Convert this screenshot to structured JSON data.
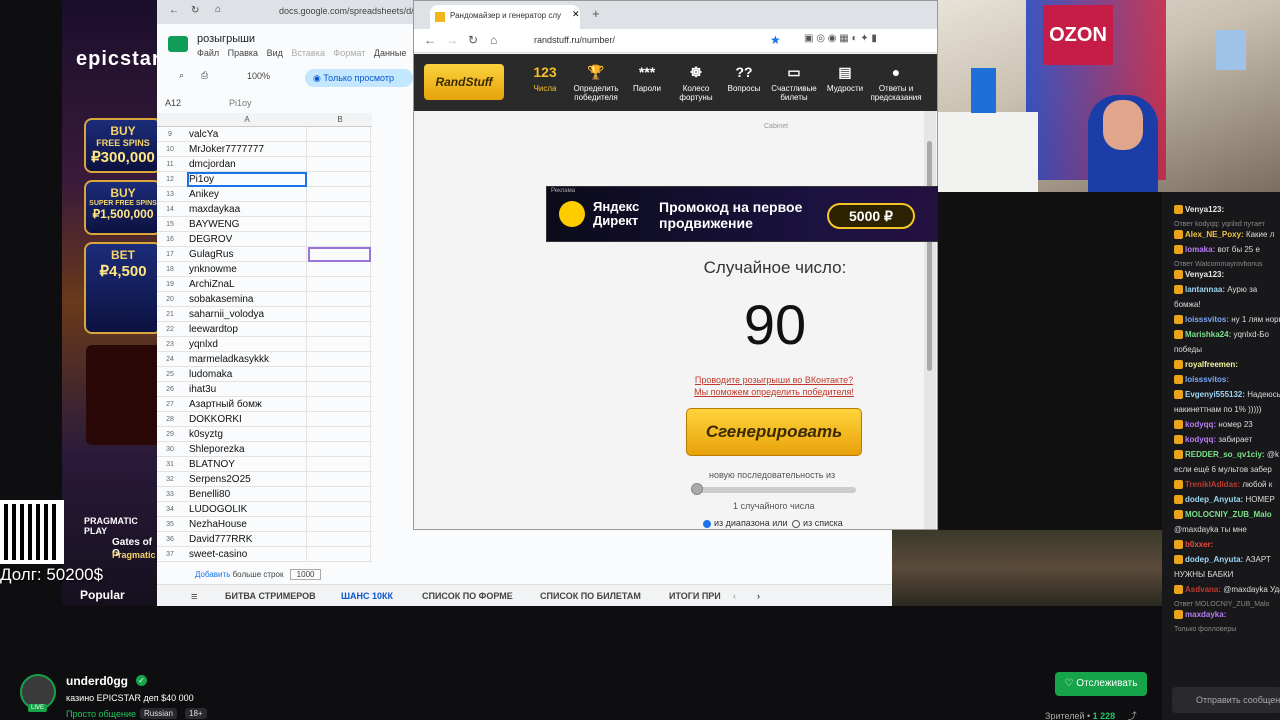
{
  "casino": {
    "logo": "epicstar",
    "tiles": [
      {
        "top": "BUY",
        "mid": "FREE SPINS",
        "big": "₽300,000"
      },
      {
        "top": "BUY",
        "mid": "SUPER FREE SPINS",
        "big": "₽1,500,000"
      },
      {
        "top": "BET",
        "mid": "",
        "big": "₽4,500"
      }
    ],
    "game_provider": "PRAGMATIC PLAY",
    "game_title": "Gates of O",
    "game_subtitle": "Pragmatic",
    "popular_label": "Popular"
  },
  "sheets": {
    "url": "docs.google.com/spreadsheets/d/",
    "title": "розыгрыши",
    "menu": [
      "Файл",
      "Правка",
      "Вид",
      "Вставка",
      "Формат",
      "Данные"
    ],
    "zoom": "100%",
    "view_only_label": "Только просмотр",
    "cell_ref": "A12",
    "formula": "Pi1oy",
    "col_a": "A",
    "col_b": "B",
    "rows": [
      {
        "n": "9",
        "v": "valcYa"
      },
      {
        "n": "10",
        "v": "MrJoker7777777"
      },
      {
        "n": "11",
        "v": "dmcjordan"
      },
      {
        "n": "12",
        "v": "Pi1oy"
      },
      {
        "n": "13",
        "v": "Anikey"
      },
      {
        "n": "14",
        "v": "maxdaykaa"
      },
      {
        "n": "15",
        "v": "BAYWENG"
      },
      {
        "n": "16",
        "v": "DEGROV"
      },
      {
        "n": "17",
        "v": "GulagRus"
      },
      {
        "n": "18",
        "v": "ynknowme"
      },
      {
        "n": "19",
        "v": "ArchiZnaL"
      },
      {
        "n": "20",
        "v": "sobakasemina"
      },
      {
        "n": "21",
        "v": "saharnii_volodya"
      },
      {
        "n": "22",
        "v": "leewardtop"
      },
      {
        "n": "23",
        "v": "yqnlxd"
      },
      {
        "n": "24",
        "v": "marmeladkasykkk"
      },
      {
        "n": "25",
        "v": "ludomaka"
      },
      {
        "n": "26",
        "v": "ihat3u"
      },
      {
        "n": "27",
        "v": "Азартный бомж"
      },
      {
        "n": "28",
        "v": "DOKKORKI"
      },
      {
        "n": "29",
        "v": "k0syztg"
      },
      {
        "n": "30",
        "v": "Shleporezka"
      },
      {
        "n": "31",
        "v": "BLATNOY"
      },
      {
        "n": "32",
        "v": "Serpens2O25"
      },
      {
        "n": "33",
        "v": "Benelli80"
      },
      {
        "n": "34",
        "v": "LUDOGOLIK"
      },
      {
        "n": "35",
        "v": "NezhaHouse"
      },
      {
        "n": "36",
        "v": "David777RRK"
      },
      {
        "n": "37",
        "v": "sweet-casino"
      }
    ],
    "add_rows": "больше строк",
    "add_rows_value": "1000",
    "sheet_tabs": [
      "БИТВА СТРИМЕРОВ",
      "ШАНС 10КК",
      "СПИСОК ПО ФОРМЕ",
      "СПИСОК ПО БИЛЕТАМ",
      "ИТОГИ ПРИ"
    ]
  },
  "randstuff": {
    "tab_title": "Рандомайзер и генератор слу",
    "url": "randstuff.ru/number/",
    "logo": "RandStuff",
    "menu": [
      {
        "glyph": "123",
        "label": "Числа"
      },
      {
        "glyph": "🏆",
        "label": "Определить победителя"
      },
      {
        "glyph": "***",
        "label": "Пароли"
      },
      {
        "glyph": "☸",
        "label": "Колесо фортуны"
      },
      {
        "glyph": "??",
        "label": "Вопросы"
      },
      {
        "glyph": "▭",
        "label": "Счастливые билеты"
      },
      {
        "glyph": "▤",
        "label": "Мудрости"
      },
      {
        "glyph": "●",
        "label": "Ответы и предсказания"
      }
    ],
    "loader": "Cabinet",
    "ad": {
      "brand_top": "Яндекс",
      "brand_bottom": "Директ",
      "promo": "Промокод на первое продвижение",
      "amount": "5000 ₽",
      "small": "Реклама"
    },
    "result_label": "Случайное число:",
    "result_value": "90",
    "promo_line1": "Проводите розыгрыши во ВКонтакте?",
    "promo_line2": "Мы поможем определить победителя!",
    "generate_button": "Сгенерировать",
    "sequence_label": "новую последовательность из",
    "count_label": "1 случайного числа",
    "radio_range": "из диапазона или",
    "radio_list": "из списка"
  },
  "webcam": {
    "brand": "OZON"
  },
  "chat": {
    "messages": [
      {
        "type": "msg",
        "user": "Venya123:",
        "text": "",
        "color": "#e9e9e9"
      },
      {
        "type": "reply",
        "text": "Ответ kodyqq: yqnlxd путает"
      },
      {
        "type": "msg",
        "user": "Alex_NE_Poxy:",
        "text": "Какие л",
        "color": "#f4c542"
      },
      {
        "type": "msg",
        "user": "lomaka:",
        "text": "вот бы 25 е",
        "color": "#b87cf5"
      },
      {
        "type": "reply",
        "text": "Ответ Watcommayrovbonus"
      },
      {
        "type": "msg",
        "user": "Venya123:",
        "text": "",
        "color": "#e9e9e9"
      },
      {
        "type": "msg",
        "user": "lantannaa:",
        "text": "Аурю за",
        "color": "#9cd6f5"
      },
      {
        "type": "cont",
        "text": "бомжа!"
      },
      {
        "type": "msg",
        "user": "loisssvitos:",
        "text": "ну 1 лям норм",
        "color": "#7aa8f7"
      },
      {
        "type": "msg",
        "user": "Marishka24:",
        "text": "yqnlxd-Бо",
        "color": "#7ee08a"
      },
      {
        "type": "cont",
        "text": "победы"
      },
      {
        "type": "msg",
        "user": "royalfreemen:",
        "text": "",
        "color": "#f5f5a0"
      },
      {
        "type": "msg",
        "user": "loisssvitos:",
        "text": "",
        "color": "#7aa8f7"
      },
      {
        "type": "msg",
        "user": "Evgenyi555132:",
        "text": "Надеюсь",
        "color": "#9cd6f5"
      },
      {
        "type": "cont",
        "text": "накинеттнам по 1% )))))"
      },
      {
        "type": "msg",
        "user": "kodyqq:",
        "text": "номер 23",
        "color": "#b87cf5"
      },
      {
        "type": "msg",
        "user": "kodyqq:",
        "text": "забирает",
        "color": "#b87cf5"
      },
      {
        "type": "msg",
        "user": "REDDER_so_qv1ciy:",
        "text": "@k",
        "color": "#7ee08a"
      },
      {
        "type": "cont",
        "text": "если ещё 6 мультов забер"
      },
      {
        "type": "msg",
        "user": "TreniklAdidas:",
        "text": "любой к",
        "color": "#c0392b"
      },
      {
        "type": "msg",
        "user": "dodep_Anyuta:",
        "text": "HOMEP",
        "color": "#9cd6f5"
      },
      {
        "type": "msg",
        "user": "MOLOCNIY_ZUB_Malo",
        "text": "",
        "color": "#7ee08a"
      },
      {
        "type": "cont",
        "text": "@maxdayka ты мне"
      },
      {
        "type": "msg",
        "user": "b0xxer:",
        "text": "",
        "color": "#e74c3c"
      },
      {
        "type": "msg",
        "user": "dodep_Anyuta:",
        "text": "АЗАРТ",
        "color": "#9cd6f5"
      },
      {
        "type": "cont",
        "text": "НУЖНЫ БАБКИ"
      },
      {
        "type": "msg",
        "user": "Asdvana:",
        "text": "@maxdayka Уда",
        "color": "#c0392b"
      },
      {
        "type": "reply",
        "text": "Ответ MOLOCNIY_ZUB_Malo"
      },
      {
        "type": "msg",
        "user": "maxdayka:",
        "text": "",
        "color": "#b87cf5"
      },
      {
        "type": "reply",
        "text": "Только фолловеры"
      }
    ],
    "send_placeholder": "Отправить сообщение"
  },
  "overlay": {
    "debt": "Долг: 50200$"
  },
  "stream": {
    "streamer": "underd0gg",
    "title": "казино EPICSTAR деп $40 000",
    "category": "Просто общение",
    "tags": [
      "Russian",
      "18+"
    ],
    "follow_button": "Отслеживать",
    "viewers_label": "Зрителей •",
    "viewers_count": "1 228"
  }
}
